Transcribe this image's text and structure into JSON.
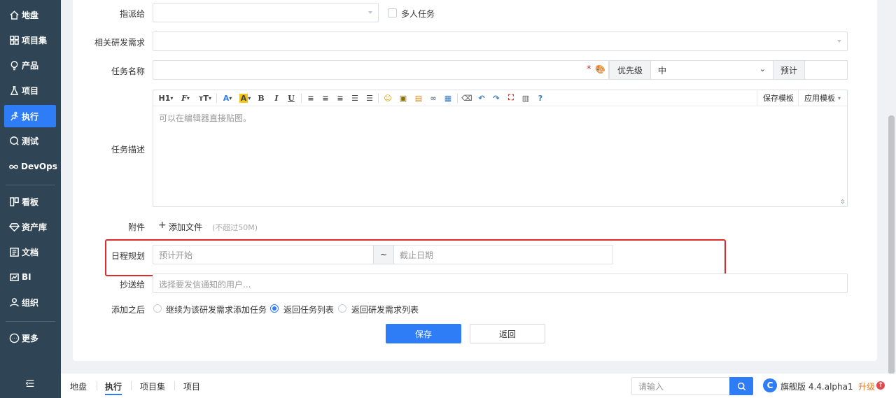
{
  "sidebar": {
    "items": [
      {
        "label": "地盘",
        "icon": "home-icon"
      },
      {
        "label": "项目集",
        "icon": "grid-icon"
      },
      {
        "label": "产品",
        "icon": "lightbulb-icon"
      },
      {
        "label": "项目",
        "icon": "flask-icon"
      },
      {
        "label": "执行",
        "icon": "run-icon",
        "active": true
      },
      {
        "label": "测试",
        "icon": "search-bug-icon"
      },
      {
        "label": "DevOps",
        "icon": "infinity-icon"
      },
      {
        "label": "看板",
        "icon": "board-icon"
      },
      {
        "label": "资产库",
        "icon": "diamond-icon"
      },
      {
        "label": "文档",
        "icon": "doc-icon"
      },
      {
        "label": "BI",
        "icon": "chart-icon"
      },
      {
        "label": "组织",
        "icon": "people-icon"
      },
      {
        "label": "更多",
        "icon": "more-icon"
      }
    ]
  },
  "form": {
    "assign_label": "指派给",
    "multi_task_label": "多人任务",
    "related_story_label": "相关研发需求",
    "task_name_label": "任务名称",
    "required_mark": "*",
    "priority_label": "优先级",
    "priority_value": "中",
    "estimate_label": "预计",
    "description_label": "任务描述",
    "editor_placeholder": "可以在编辑器直接贴图。",
    "save_template": "保存模板",
    "apply_template": "应用模板",
    "attachment_label": "附件",
    "add_file": "添加文件",
    "file_limit": "(不超过50M)",
    "schedule_label": "日程规划",
    "start_placeholder": "预计开始",
    "tilde": "~",
    "end_placeholder": "截止日期",
    "cc_label": "抄送给",
    "cc_placeholder": "选择要发信通知的用户...",
    "after_label": "添加之后",
    "after_options": [
      {
        "label": "继续为该研发需求添加任务",
        "checked": false
      },
      {
        "label": "返回任务列表",
        "checked": true
      },
      {
        "label": "返回研发需求列表",
        "checked": false
      }
    ],
    "save_button": "保存",
    "back_button": "返回"
  },
  "editor_toolbar": {
    "heading": "H1",
    "font": "F",
    "font_size": "тT",
    "font_color": "A",
    "bg_color": "A",
    "bold": "B",
    "italic": "I",
    "underline": "U"
  },
  "footer": {
    "nav": [
      "地盘",
      "执行",
      "项目集",
      "项目"
    ],
    "search_placeholder": "请输入",
    "version": "旗舰版 4.4.alpha1",
    "upgrade": "升级"
  },
  "colors": {
    "sidebar_bg": "#2f4555",
    "accent": "#2e7cf6",
    "highlight": "#e02b2b"
  }
}
